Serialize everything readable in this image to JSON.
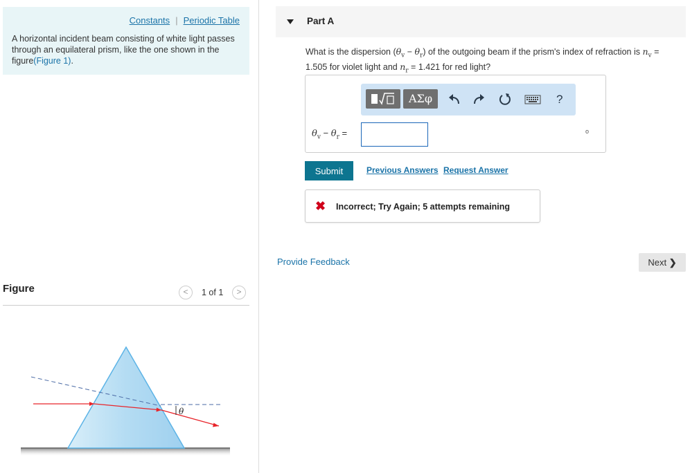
{
  "constants_link": "Constants",
  "link_separator": "|",
  "periodic_table_link": "Periodic Table",
  "problem_intro": "A horizontal incident beam consisting of white light passes through an equilateral prism, like the one shown in the figure",
  "figure_ref": "(Figure 1)",
  "figure_ref_end": ".",
  "figure_section": {
    "title": "Figure",
    "pager": "1 of 1",
    "angle_label": "θ",
    "icons": [
      "chevron-left-icon",
      "chevron-right-icon"
    ]
  },
  "part": {
    "label": "Part A"
  },
  "question": {
    "q1": "What is the dispersion (",
    "theta_v": "θ",
    "sub_v": "v",
    "minus": " − ",
    "theta_r": "θ",
    "sub_r": "r",
    "q2": ") of the outgoing beam if the prism's index of refraction is ",
    "n": "n",
    "eq_v": " = 1.505 for violet light and ",
    "eq_r": " = 1.421 for red light?"
  },
  "answer": {
    "label": "θv − θr =",
    "value": "",
    "unit": "o"
  },
  "toolbar": {
    "greek_label": "ΑΣφ",
    "help_label": "?",
    "icons": [
      "templates-icon",
      "greek-letters-icon",
      "undo-icon",
      "redo-icon",
      "reset-icon",
      "keyboard-icon",
      "help-icon"
    ]
  },
  "submit_label": "Submit",
  "previous_answers_label": "Previous Answers",
  "request_answer_label": "Request Answer",
  "feedback": {
    "icon": "x-icon",
    "message": "Incorrect; Try Again; 5 attempts remaining"
  },
  "provide_feedback_label": "Provide Feedback",
  "next_label": "Next",
  "colors": {
    "info_bg": "#e8f5f7",
    "link": "#1a73a8",
    "submit_bg": "#0d7590",
    "toolbar_bg": "#cfe3f5",
    "error": "#d0021b",
    "ray_red": "#e8242a"
  }
}
